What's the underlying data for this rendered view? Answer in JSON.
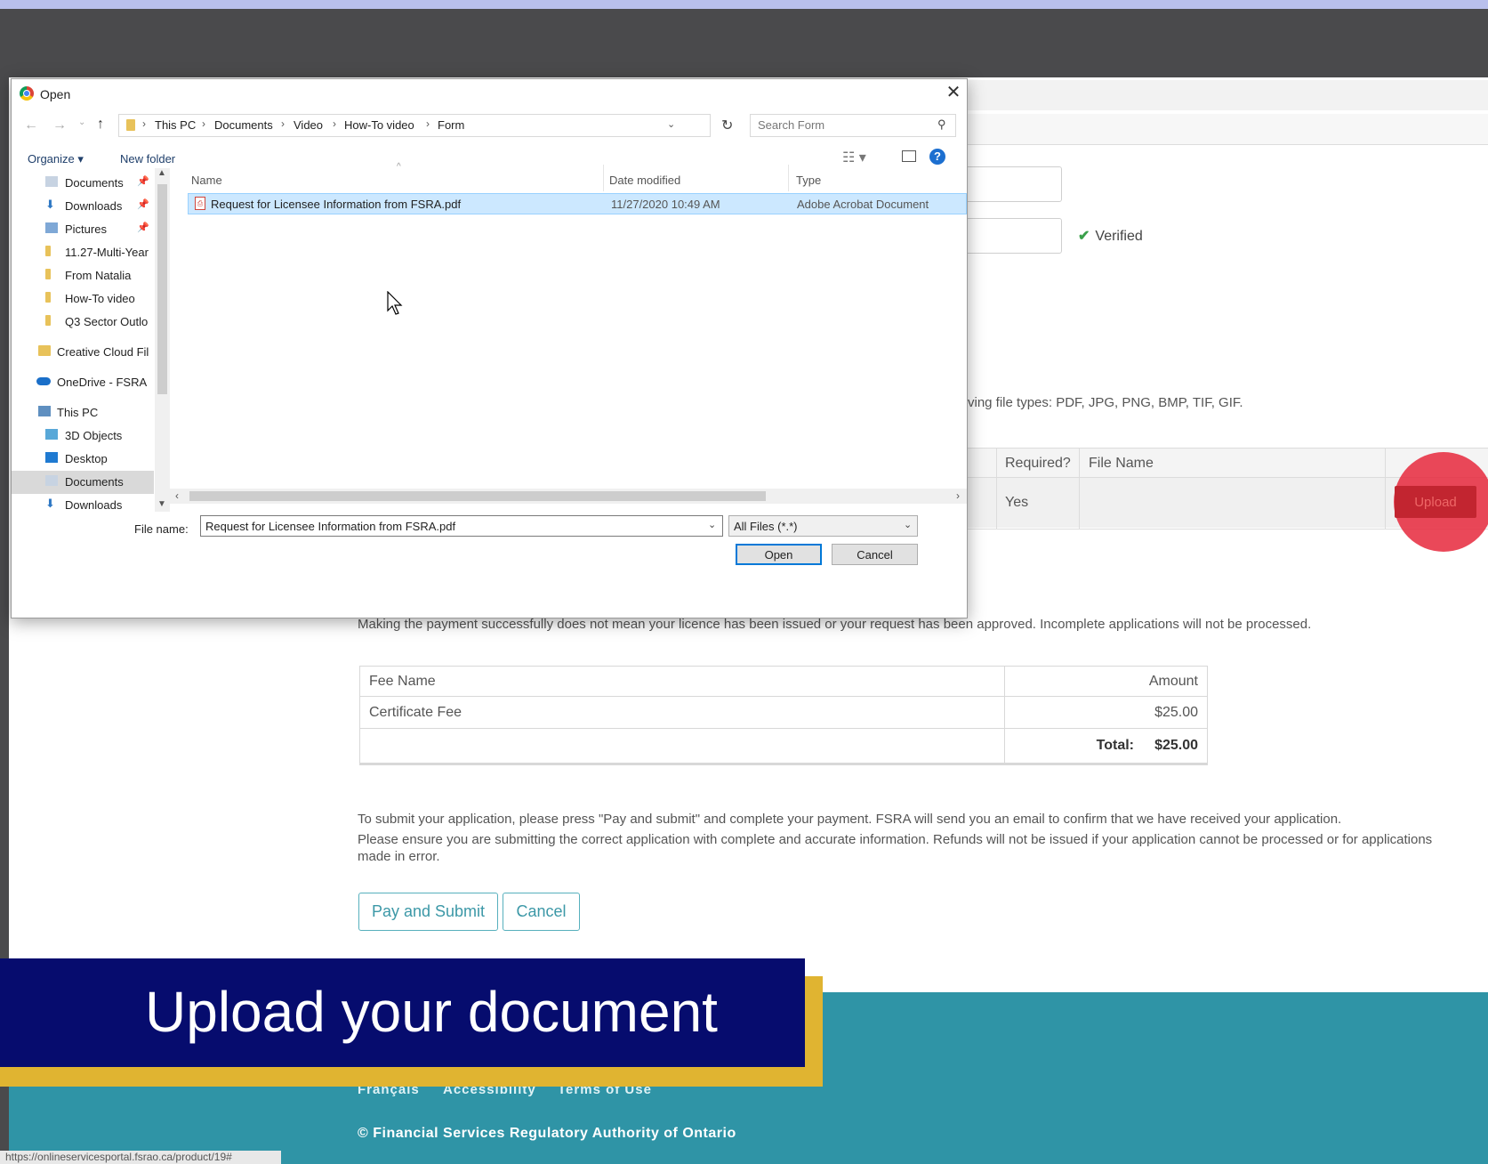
{
  "dialog": {
    "title": "Open",
    "breadcrumbs": [
      "This PC",
      "Documents",
      "Video",
      "How-To video",
      "Form"
    ],
    "search_placeholder": "Search Form",
    "toolbar": {
      "organize": "Organize ▾",
      "new_folder": "New folder"
    },
    "nav_items": [
      {
        "label": "Documents",
        "pinned": true
      },
      {
        "label": "Downloads",
        "pinned": true
      },
      {
        "label": "Pictures",
        "pinned": true
      },
      {
        "label": "11.27-Multi-Year"
      },
      {
        "label": "From Natalia"
      },
      {
        "label": "How-To video"
      },
      {
        "label": "Q3 Sector Outlo"
      },
      {
        "label": "Creative Cloud Fil"
      },
      {
        "label": "OneDrive - FSRA"
      },
      {
        "label": "This PC"
      },
      {
        "label": "3D Objects"
      },
      {
        "label": "Desktop"
      },
      {
        "label": "Documents",
        "selected": true
      },
      {
        "label": "Downloads"
      }
    ],
    "columns": {
      "name": "Name",
      "date": "Date modified",
      "type": "Type"
    },
    "files": [
      {
        "name": "Request for Licensee Information from FSRA.pdf",
        "date": "11/27/2020 10:49 AM",
        "type": "Adobe Acrobat Document"
      }
    ],
    "file_name_label": "File name:",
    "file_name_value": "Request for Licensee Information from FSRA.pdf",
    "filter": "All Files (*.*)",
    "open_label": "Open",
    "cancel_label": "Cancel"
  },
  "page": {
    "verified": "Verified",
    "file_types_note": "ving file types: PDF, JPG, PNG, BMP, TIF, GIF.",
    "doc_table": {
      "headers": {
        "required": "Required?",
        "file_name": "File Name"
      },
      "row": {
        "required": "Yes",
        "file_name": ""
      },
      "upload_label": "Upload"
    },
    "payment_note": "Making the payment successfully does not mean your licence has been issued or your request has been approved. Incomplete applications will not be processed.",
    "fee_table": {
      "headers": {
        "fee_name": "Fee Name",
        "amount": "Amount"
      },
      "rows": [
        {
          "fee_name": "Certificate Fee",
          "amount": "$25.00"
        }
      ],
      "total_label": "Total:",
      "total_value": "$25.00"
    },
    "submit_note_1": "To submit your application, please press \"Pay and submit\" and complete your payment. FSRA will send you an email to confirm that we have received your application.",
    "submit_note_2": "Please ensure you are submitting the correct application with complete and accurate information. Refunds will not be issued if your application cannot be processed or for applications made in error.",
    "pay_submit_label": "Pay and Submit",
    "cancel_label": "Cancel",
    "footer": {
      "links": [
        "Français",
        "Accessibility",
        "Terms of Use"
      ],
      "copyright": "© Financial Services Regulatory Authority of Ontario"
    },
    "status_url": "https://onlineservicesportal.fsrao.ca/product/19#"
  },
  "banner": {
    "text": "Upload your document"
  },
  "colors": {
    "banner_bg": "#060c6e",
    "banner_accent": "#e0b431",
    "footer_bg": "#2f94a6",
    "upload_red": "#c22530",
    "accent_teal": "#3c98a7"
  }
}
